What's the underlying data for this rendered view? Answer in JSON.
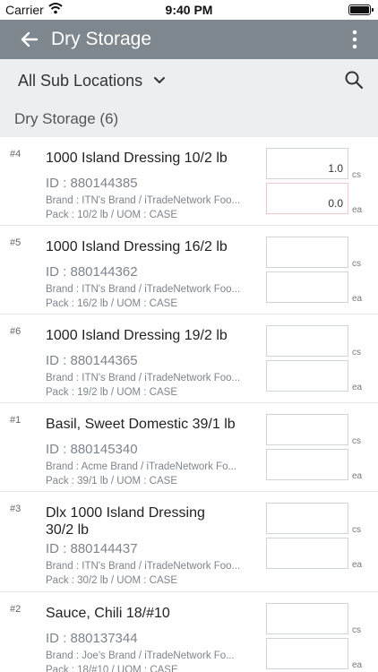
{
  "status_bar": {
    "carrier": "Carrier",
    "time": "9:40 PM"
  },
  "app_bar": {
    "title": "Dry Storage"
  },
  "filter": {
    "location_label": "All Sub Locations"
  },
  "section": {
    "title": "Dry Storage (6)"
  },
  "items": [
    {
      "rank": "#4",
      "name": "1000 Island Dressing  10/2 lb",
      "id_text": "ID : 880144385",
      "brand": "Brand : ITN's Brand / iTradeNetwork Foo...",
      "pack": "Pack : 10/2 lb / UOM : CASE",
      "cs_value": "1.0",
      "ea_value": "0.0",
      "cs_unit": "cs",
      "ea_unit": "ea"
    },
    {
      "rank": "#5",
      "name": "1000 Island Dressing  16/2 lb",
      "id_text": "ID : 880144362",
      "brand": "Brand : ITN's Brand / iTradeNetwork Foo...",
      "pack": "Pack : 16/2 lb / UOM : CASE",
      "cs_value": "",
      "ea_value": "",
      "cs_unit": "cs",
      "ea_unit": "ea"
    },
    {
      "rank": "#6",
      "name": "1000 Island Dressing  19/2 lb",
      "id_text": "ID : 880144365",
      "brand": "Brand : ITN's Brand / iTradeNetwork Foo...",
      "pack": "Pack : 19/2 lb / UOM : CASE",
      "cs_value": "",
      "ea_value": "",
      "cs_unit": "cs",
      "ea_unit": "ea"
    },
    {
      "rank": "#1",
      "name": "Basil, Sweet Domestic  39/1 lb",
      "id_text": "ID : 880145340",
      "brand": "Brand : Acme Brand / iTradeNetwork Fo...",
      "pack": "Pack : 39/1 lb / UOM : CASE",
      "cs_value": "",
      "ea_value": "",
      "cs_unit": "cs",
      "ea_unit": "ea"
    },
    {
      "rank": "#3",
      "name": "Dlx 1000 Island Dressing  30/2 lb",
      "id_text": "ID : 880144437",
      "brand": "Brand : ITN's Brand / iTradeNetwork Foo...",
      "pack": "Pack : 30/2 lb / UOM : CASE",
      "cs_value": "",
      "ea_value": "",
      "cs_unit": "cs",
      "ea_unit": "ea"
    },
    {
      "rank": "#2",
      "name": "Sauce, Chili  18/#10",
      "id_text": "ID : 880137344",
      "brand": "Brand : Joe's Brand / iTradeNetwork Fo...",
      "pack": "Pack : 18/#10 / UOM : CASE",
      "cs_value": "",
      "ea_value": "",
      "cs_unit": "cs",
      "ea_unit": "ea"
    }
  ]
}
